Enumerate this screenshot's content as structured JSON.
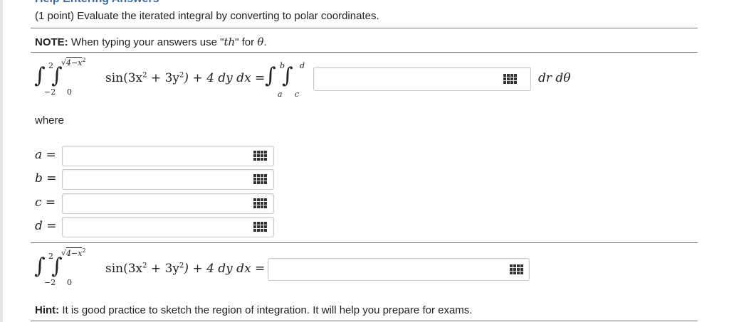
{
  "header": {
    "help_link": "Help Entering Answers",
    "intro": "(1 point) Evaluate the iterated integral by converting to polar coordinates."
  },
  "note": {
    "label": "NOTE:",
    "text_before": " When typing your answers use \"",
    "th": "th",
    "text_middle": "\" for ",
    "theta": "θ",
    "text_after": "."
  },
  "integral": {
    "outer_upper": "2",
    "outer_lower": "−2",
    "inner_upper": "4−x",
    "inner_upper_exp": "2",
    "inner_lower": "0",
    "integrand": "sin(3x",
    "integrand_mid": " + 3y",
    "integrand_end": ") + 4 dy dx =",
    "polar_outer_upper": "b",
    "polar_outer_lower": "a",
    "polar_inner_upper": "d",
    "polar_inner_lower": "c",
    "differentials": "dr dθ",
    "polar_integrand_value": ""
  },
  "where_label": "where",
  "limits": [
    {
      "label": "a =",
      "value": ""
    },
    {
      "label": "b =",
      "value": ""
    },
    {
      "label": "c =",
      "value": ""
    },
    {
      "label": "d =",
      "value": ""
    }
  ],
  "final": {
    "integrand": "sin(3x",
    "integrand_mid": " + 3y",
    "integrand_end": ") + 4 dy dx =",
    "value": ""
  },
  "hint": {
    "label": "Hint:",
    "text": " It is good practice to sketch the region of integration. It will help you prepare for exams."
  },
  "icons": {
    "equation_editor": "equation-editor-grid-icon"
  }
}
